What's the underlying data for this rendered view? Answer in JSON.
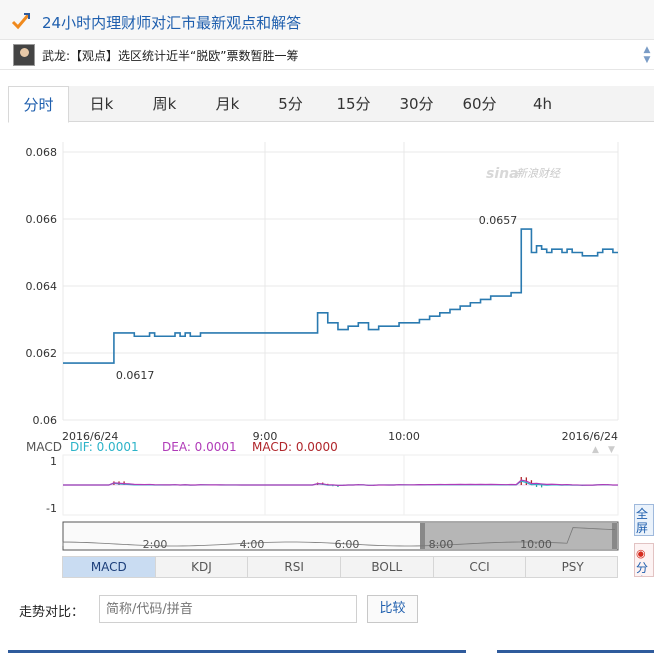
{
  "header": {
    "title": "24小时内理财师对汇市最新观点和解答",
    "logo_icon": "check-arrow-icon"
  },
  "news": {
    "text": "武龙:【观点】选区统计近半“脱欧”票数暂胜一筹",
    "avatar_icon": "avatar-icon"
  },
  "tabs": [
    {
      "label": "分时",
      "active": true
    },
    {
      "label": "日k"
    },
    {
      "label": "周k"
    },
    {
      "label": "月k"
    },
    {
      "label": "5分"
    },
    {
      "label": "15分"
    },
    {
      "label": "30分"
    },
    {
      "label": "60分"
    },
    {
      "label": "4h"
    }
  ],
  "chart_data": {
    "type": "line",
    "y_ticks": [
      "0.068",
      "0.066",
      "0.064",
      "0.062",
      "0.06"
    ],
    "ylim": [
      0.06,
      0.068
    ],
    "x_ticks": [
      "2016/6/24",
      "9:00",
      "10:00",
      "2016/6/24"
    ],
    "annotations": {
      "min": "0.0617",
      "max": "0.0657"
    },
    "watermark": "新浪财经",
    "series": [
      {
        "values": [
          0.0617,
          0.0617,
          0.0617,
          0.0617,
          0.0617,
          0.0617,
          0.0617,
          0.0617,
          0.0617,
          0.0617,
          0.0626,
          0.0626,
          0.0626,
          0.0626,
          0.0625,
          0.0625,
          0.0625,
          0.0626,
          0.0625,
          0.0625,
          0.0625,
          0.0625,
          0.0626,
          0.0625,
          0.0626,
          0.0625,
          0.0625,
          0.0626,
          0.0626,
          0.0626,
          0.0626,
          0.0626,
          0.0626,
          0.0626,
          0.0626,
          0.0626,
          0.0626,
          0.0626,
          0.0626,
          0.0626,
          0.0626,
          0.0626,
          0.0626,
          0.0626,
          0.0626,
          0.0626,
          0.0626,
          0.0626,
          0.0626,
          0.0626,
          0.0632,
          0.0632,
          0.0629,
          0.0629,
          0.0627,
          0.0627,
          0.0628,
          0.0628,
          0.0629,
          0.0629,
          0.0627,
          0.0627,
          0.0628,
          0.0628,
          0.0628,
          0.0628,
          0.0629,
          0.0629,
          0.0629,
          0.0629,
          0.063,
          0.063,
          0.0631,
          0.0631,
          0.0632,
          0.0632,
          0.0633,
          0.0633,
          0.0634,
          0.0634,
          0.0635,
          0.0635,
          0.0636,
          0.0636,
          0.0637,
          0.0637,
          0.0637,
          0.0637,
          0.0638,
          0.0638,
          0.0657,
          0.0657,
          0.065,
          0.0652,
          0.0651,
          0.065,
          0.0651,
          0.0651,
          0.065,
          0.0651,
          0.065,
          0.065,
          0.0649,
          0.0649,
          0.0649,
          0.065,
          0.0651,
          0.0651,
          0.065,
          0.065
        ]
      }
    ],
    "macd": {
      "label": "MACD",
      "dif": "DIF: 0.0001",
      "dea": "DEA: 0.0001",
      "macd": "MACD: 0.0000",
      "y_ticks": [
        "1",
        "-1"
      ],
      "dif_color": "#2bb3c8",
      "dea_color": "#b03bb8",
      "macd_color": "#b0262b"
    },
    "navigator_ticks": [
      "2:00",
      "4:00",
      "6:00",
      "8:00",
      "10:00"
    ]
  },
  "indicators": [
    {
      "label": "MACD",
      "active": true
    },
    {
      "label": "KDJ"
    },
    {
      "label": "RSI"
    },
    {
      "label": "BOLL"
    },
    {
      "label": "CCI"
    },
    {
      "label": "PSY"
    }
  ],
  "side": {
    "fullscreen": "全屏查看",
    "share": "分享"
  },
  "compare": {
    "label": "走势对比：",
    "placeholder": "简称/代码/拼音",
    "button": "比较"
  },
  "colors": {
    "line": "#2a7ab0",
    "accent": "#1f5fae"
  }
}
